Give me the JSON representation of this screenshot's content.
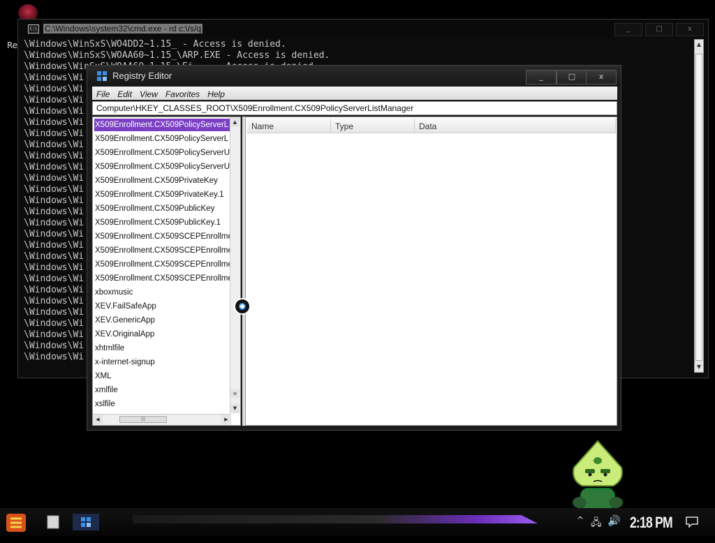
{
  "desktop": {
    "icon_label": "Re"
  },
  "cmd": {
    "title": "C:\\Windows\\system32\\cmd.exe - rd  c:\\/s/q",
    "lines": [
      "\\Windows\\WinSxS\\WO4DD2~1.15_ - Access is denied.",
      "\\Windows\\WinSxS\\WOAA60~1.15_\\ARP.EXE - Access is denied.",
      "\\Windows\\WinSxS\\WOAA60~1.15_\\Ei... - Access is denied.",
      "\\Windows\\Wi",
      "\\Windows\\Wi",
      "\\Windows\\Wi",
      "\\Windows\\Wi",
      "\\Windows\\Wi",
      "\\Windows\\Wi",
      "\\Windows\\Wi",
      "\\Windows\\Wi",
      "\\Windows\\Wi",
      "\\Windows\\Wi",
      "\\Windows\\Wi",
      "\\Windows\\Wi",
      "\\Windows\\Wi",
      "\\Windows\\Wi",
      "\\Windows\\Wi",
      "\\Windows\\Wi",
      "\\Windows\\Wi",
      "\\Windows\\Wi",
      "\\Windows\\Wi",
      "\\Windows\\Wi",
      "\\Windows\\Wi",
      "\\Windows\\Wi",
      "\\Windows\\Wi",
      "\\Windows\\Wi",
      "\\Windows\\Wi",
      "\\Windows\\Wi"
    ],
    "controls": {
      "minimize": "_",
      "maximize": "□",
      "close": "x"
    }
  },
  "regedit": {
    "title": "Registry Editor",
    "controls": {
      "minimize": "_",
      "maximize": "□",
      "close": "x"
    },
    "menu": [
      "File",
      "Edit",
      "View",
      "Favorites",
      "Help"
    ],
    "address": "Computer\\HKEY_CLASSES_ROOT\\X509Enrollment.CX509PolicyServerListManager",
    "tree_items": [
      "X509Enrollment.CX509PolicyServerL",
      "X509Enrollment.CX509PolicyServerL",
      "X509Enrollment.CX509PolicyServerU",
      "X509Enrollment.CX509PolicyServerU",
      "X509Enrollment.CX509PrivateKey",
      "X509Enrollment.CX509PrivateKey.1",
      "X509Enrollment.CX509PublicKey",
      "X509Enrollment.CX509PublicKey.1",
      "X509Enrollment.CX509SCEPEnrollme",
      "X509Enrollment.CX509SCEPEnrollme",
      "X509Enrollment.CX509SCEPEnrollme",
      "X509Enrollment.CX509SCEPEnrollme",
      "xboxmusic",
      "XEV.FailSafeApp",
      "XEV.GenericApp",
      "XEV.OriginalApp",
      "xhtmlfile",
      "x-internet-signup",
      "XML",
      "xmlfile",
      "xslfile"
    ],
    "selected_index": 0,
    "columns": [
      "Name",
      "Type",
      "Data"
    ]
  },
  "taskbar": {
    "clock": "2:18 PM"
  },
  "colors": {
    "accent": "#7b3fc4",
    "glow": "#9a5cf0"
  }
}
